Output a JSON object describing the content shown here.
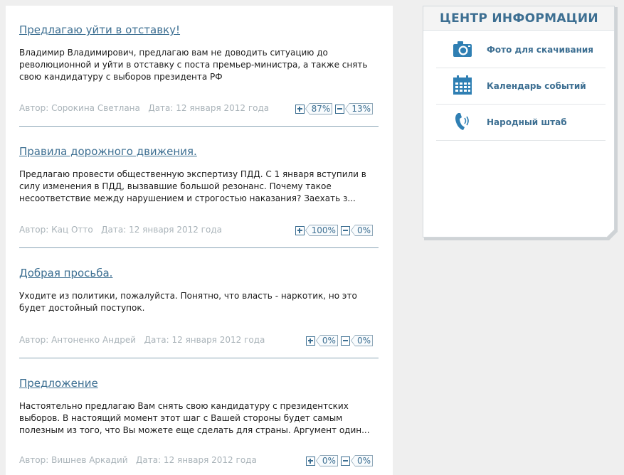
{
  "posts": [
    {
      "title": "Предлагаю уйти в отставку!",
      "text": "Владимир Владимирович, предлагаю вам не доводить ситуацию до революционной и уйти в отставку с поста премьер-министра, а также снять свою кандидатуру с выборов президента РФ",
      "author": "Автор: Сорокина Светлана",
      "date": "Дата: 12 января 2012 года",
      "plus_pct": "87%",
      "minus_pct": "13%"
    },
    {
      "title": "Правила дорожного движения.",
      "text": "Предлагаю провести общественную экспертизу ПДД. С 1 января вступили в силу изменения в ПДД, вызвавшие большой резонанс. Почему такое несоответствие между нарушением и строгостью наказания? Заехать з...",
      "author": "Автор: Кац Отто",
      "date": "Дата: 12 января 2012 года",
      "plus_pct": "100%",
      "minus_pct": "0%"
    },
    {
      "title": "Добрая просьба.",
      "text": "Уходите из политики, пожалуйста. Понятно, что власть - наркотик, но это будет достойный поступок.",
      "author": "Автор: Антоненко Андрей",
      "date": "Дата: 12 января 2012 года",
      "plus_pct": "0%",
      "minus_pct": "0%"
    },
    {
      "title": "Предложение",
      "text": "Настоятельно предлагаю Вам снять свою кандидатуру с президентских выборов. В настоящий момент этот шаг с Вашей стороны будет самым полезным из того, что Вы можете еще сделать для страны. Аргумент один...",
      "author": "Автор: Вишнев Аркадий",
      "date": "Дата: 12 января 2012 года",
      "plus_pct": "0%",
      "minus_pct": "0%"
    }
  ],
  "info_center": {
    "title": "ЦЕНТР ИНФОРМАЦИИ",
    "items": [
      {
        "label": "Фото для скачивания",
        "icon": "camera-icon"
      },
      {
        "label": "Календарь событий",
        "icon": "calendar-icon"
      },
      {
        "label": "Народный штаб",
        "icon": "phone-icon"
      }
    ]
  },
  "colors": {
    "accent": "#3d6f92",
    "meta_text": "#a9b3b9",
    "background": "#efefef"
  }
}
